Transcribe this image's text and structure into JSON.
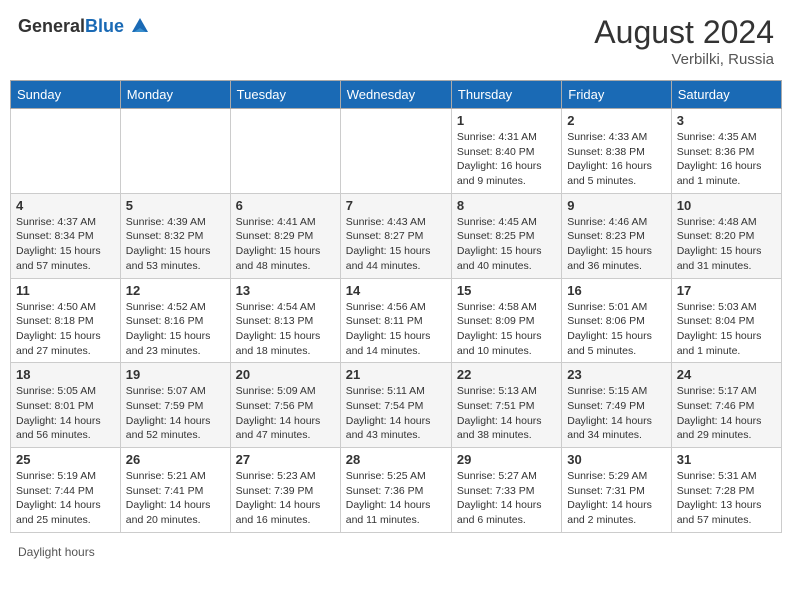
{
  "header": {
    "logo_general": "General",
    "logo_blue": "Blue",
    "month_year": "August 2024",
    "location": "Verbilki, Russia"
  },
  "days_of_week": [
    "Sunday",
    "Monday",
    "Tuesday",
    "Wednesday",
    "Thursday",
    "Friday",
    "Saturday"
  ],
  "weeks": [
    [
      {
        "day": "",
        "info": ""
      },
      {
        "day": "",
        "info": ""
      },
      {
        "day": "",
        "info": ""
      },
      {
        "day": "",
        "info": ""
      },
      {
        "day": "1",
        "info": "Sunrise: 4:31 AM\nSunset: 8:40 PM\nDaylight: 16 hours\nand 9 minutes."
      },
      {
        "day": "2",
        "info": "Sunrise: 4:33 AM\nSunset: 8:38 PM\nDaylight: 16 hours\nand 5 minutes."
      },
      {
        "day": "3",
        "info": "Sunrise: 4:35 AM\nSunset: 8:36 PM\nDaylight: 16 hours\nand 1 minute."
      }
    ],
    [
      {
        "day": "4",
        "info": "Sunrise: 4:37 AM\nSunset: 8:34 PM\nDaylight: 15 hours\nand 57 minutes."
      },
      {
        "day": "5",
        "info": "Sunrise: 4:39 AM\nSunset: 8:32 PM\nDaylight: 15 hours\nand 53 minutes."
      },
      {
        "day": "6",
        "info": "Sunrise: 4:41 AM\nSunset: 8:29 PM\nDaylight: 15 hours\nand 48 minutes."
      },
      {
        "day": "7",
        "info": "Sunrise: 4:43 AM\nSunset: 8:27 PM\nDaylight: 15 hours\nand 44 minutes."
      },
      {
        "day": "8",
        "info": "Sunrise: 4:45 AM\nSunset: 8:25 PM\nDaylight: 15 hours\nand 40 minutes."
      },
      {
        "day": "9",
        "info": "Sunrise: 4:46 AM\nSunset: 8:23 PM\nDaylight: 15 hours\nand 36 minutes."
      },
      {
        "day": "10",
        "info": "Sunrise: 4:48 AM\nSunset: 8:20 PM\nDaylight: 15 hours\nand 31 minutes."
      }
    ],
    [
      {
        "day": "11",
        "info": "Sunrise: 4:50 AM\nSunset: 8:18 PM\nDaylight: 15 hours\nand 27 minutes."
      },
      {
        "day": "12",
        "info": "Sunrise: 4:52 AM\nSunset: 8:16 PM\nDaylight: 15 hours\nand 23 minutes."
      },
      {
        "day": "13",
        "info": "Sunrise: 4:54 AM\nSunset: 8:13 PM\nDaylight: 15 hours\nand 18 minutes."
      },
      {
        "day": "14",
        "info": "Sunrise: 4:56 AM\nSunset: 8:11 PM\nDaylight: 15 hours\nand 14 minutes."
      },
      {
        "day": "15",
        "info": "Sunrise: 4:58 AM\nSunset: 8:09 PM\nDaylight: 15 hours\nand 10 minutes."
      },
      {
        "day": "16",
        "info": "Sunrise: 5:01 AM\nSunset: 8:06 PM\nDaylight: 15 hours\nand 5 minutes."
      },
      {
        "day": "17",
        "info": "Sunrise: 5:03 AM\nSunset: 8:04 PM\nDaylight: 15 hours\nand 1 minute."
      }
    ],
    [
      {
        "day": "18",
        "info": "Sunrise: 5:05 AM\nSunset: 8:01 PM\nDaylight: 14 hours\nand 56 minutes."
      },
      {
        "day": "19",
        "info": "Sunrise: 5:07 AM\nSunset: 7:59 PM\nDaylight: 14 hours\nand 52 minutes."
      },
      {
        "day": "20",
        "info": "Sunrise: 5:09 AM\nSunset: 7:56 PM\nDaylight: 14 hours\nand 47 minutes."
      },
      {
        "day": "21",
        "info": "Sunrise: 5:11 AM\nSunset: 7:54 PM\nDaylight: 14 hours\nand 43 minutes."
      },
      {
        "day": "22",
        "info": "Sunrise: 5:13 AM\nSunset: 7:51 PM\nDaylight: 14 hours\nand 38 minutes."
      },
      {
        "day": "23",
        "info": "Sunrise: 5:15 AM\nSunset: 7:49 PM\nDaylight: 14 hours\nand 34 minutes."
      },
      {
        "day": "24",
        "info": "Sunrise: 5:17 AM\nSunset: 7:46 PM\nDaylight: 14 hours\nand 29 minutes."
      }
    ],
    [
      {
        "day": "25",
        "info": "Sunrise: 5:19 AM\nSunset: 7:44 PM\nDaylight: 14 hours\nand 25 minutes."
      },
      {
        "day": "26",
        "info": "Sunrise: 5:21 AM\nSunset: 7:41 PM\nDaylight: 14 hours\nand 20 minutes."
      },
      {
        "day": "27",
        "info": "Sunrise: 5:23 AM\nSunset: 7:39 PM\nDaylight: 14 hours\nand 16 minutes."
      },
      {
        "day": "28",
        "info": "Sunrise: 5:25 AM\nSunset: 7:36 PM\nDaylight: 14 hours\nand 11 minutes."
      },
      {
        "day": "29",
        "info": "Sunrise: 5:27 AM\nSunset: 7:33 PM\nDaylight: 14 hours\nand 6 minutes."
      },
      {
        "day": "30",
        "info": "Sunrise: 5:29 AM\nSunset: 7:31 PM\nDaylight: 14 hours\nand 2 minutes."
      },
      {
        "day": "31",
        "info": "Sunrise: 5:31 AM\nSunset: 7:28 PM\nDaylight: 13 hours\nand 57 minutes."
      }
    ]
  ],
  "footer": {
    "daylight_label": "Daylight hours"
  }
}
